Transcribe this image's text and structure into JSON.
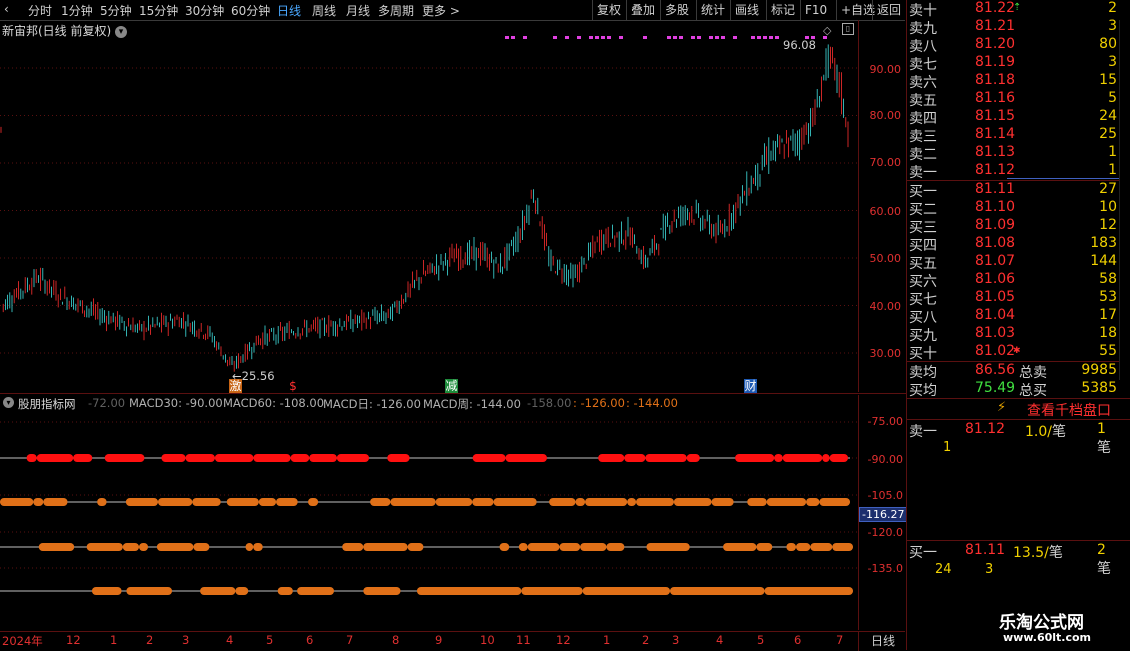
{
  "toolbar": {
    "periods": [
      "分时",
      "1分钟",
      "5分钟",
      "15分钟",
      "30分钟",
      "60分钟",
      "日线",
      "周线",
      "月线",
      "多周期",
      "更多 >"
    ],
    "active_period": "日线",
    "right_buttons": [
      "复权",
      "叠加",
      "多股",
      "统计",
      "画线",
      "F10",
      "+自选",
      "返回"
    ],
    "right_buttons_extra": [
      "标记"
    ]
  },
  "chart": {
    "title": "新宙邦(日线 前复权)",
    "y_ticks": [
      "90.00",
      "80.00",
      "70.00",
      "60.00",
      "50.00",
      "40.00",
      "30.00"
    ],
    "high_label": "96.08",
    "low_label": "25.56",
    "markers": [
      {
        "text": "激",
        "color": "#ffffff",
        "bg": "#c86414"
      },
      {
        "text": "$",
        "color": "#ff3030",
        "bg": ""
      },
      {
        "text": "减",
        "color": "#ffffff",
        "bg": "#1e8c3c"
      },
      {
        "text": "财",
        "color": "#ffffff",
        "bg": "#1e5ab4"
      }
    ]
  },
  "indicator": {
    "name": "股朋指标网",
    "header_items": [
      {
        "text": "-72.00",
        "color": "#606060"
      },
      {
        "text": "MACD30: -90.00",
        "color": "#b0b0b0"
      },
      {
        "text": "MACD60: -108.00",
        "color": "#b0b0b0"
      },
      {
        "text": "MACD日: -126.00",
        "color": "#b0b0b0"
      },
      {
        "text": "MACD周: -144.00",
        "color": "#b0b0b0"
      },
      {
        "text": "-158.00",
        "color": "#606060"
      },
      {
        "text": ": -126.00",
        "color": "#e07018"
      },
      {
        "text": ": -144.00",
        "color": "#e07018"
      }
    ],
    "y_ticks": [
      "-75.00",
      "-90.00",
      "-105.0",
      "-120.0",
      "-135.0"
    ],
    "current_value": "-116.27"
  },
  "timeline": {
    "labels": [
      "2024年",
      "12",
      "1",
      "2",
      "3",
      "4",
      "5",
      "6",
      "7",
      "8",
      "9",
      "10",
      "11",
      "12",
      "1",
      "2",
      "3",
      "4",
      "5",
      "6",
      "7"
    ],
    "period_label": "日线"
  },
  "orderbook": {
    "sells": [
      {
        "label": "卖十",
        "price": "81.22",
        "vol": "2"
      },
      {
        "label": "卖九",
        "price": "81.21",
        "vol": "3"
      },
      {
        "label": "卖八",
        "price": "81.20",
        "vol": "80"
      },
      {
        "label": "卖七",
        "price": "81.19",
        "vol": "3"
      },
      {
        "label": "卖六",
        "price": "81.18",
        "vol": "15"
      },
      {
        "label": "卖五",
        "price": "81.16",
        "vol": "5"
      },
      {
        "label": "卖四",
        "price": "81.15",
        "vol": "24"
      },
      {
        "label": "卖三",
        "price": "81.14",
        "vol": "25"
      },
      {
        "label": "卖二",
        "price": "81.13",
        "vol": "1"
      },
      {
        "label": "卖一",
        "price": "81.12",
        "vol": "1"
      }
    ],
    "buys": [
      {
        "label": "买一",
        "price": "81.11",
        "vol": "27"
      },
      {
        "label": "买二",
        "price": "81.10",
        "vol": "10"
      },
      {
        "label": "买三",
        "price": "81.09",
        "vol": "12"
      },
      {
        "label": "买四",
        "price": "81.08",
        "vol": "183"
      },
      {
        "label": "买五",
        "price": "81.07",
        "vol": "144"
      },
      {
        "label": "买六",
        "price": "81.06",
        "vol": "58"
      },
      {
        "label": "买七",
        "price": "81.05",
        "vol": "53"
      },
      {
        "label": "买八",
        "price": "81.04",
        "vol": "17"
      },
      {
        "label": "买九",
        "price": "81.03",
        "vol": "18"
      },
      {
        "label": "买十",
        "price": "81.02",
        "vol": "55"
      }
    ],
    "sell_avg_label": "卖均",
    "sell_avg": "86.56",
    "total_sell_label": "总卖",
    "total_sell": "9985",
    "buy_avg_label": "买均",
    "buy_avg": "75.49",
    "total_buy_label": "总买",
    "total_buy": "5385",
    "view_button": "查看千档盘口",
    "ask1": {
      "label": "卖一",
      "price": "81.12",
      "per": "1.0/",
      "unit": "笔",
      "count": "1",
      "unit2": "笔",
      "detail": "1"
    },
    "bid1": {
      "label": "买一",
      "price": "81.11",
      "per": "13.5/",
      "unit": "笔",
      "count": "2",
      "unit2": "笔",
      "detail1": "24",
      "detail2": "3"
    }
  },
  "watermark": {
    "line1": "乐淘公式网",
    "line2": "www.60lt.com"
  },
  "colors": {
    "up": "#ff3030",
    "down": "#40e0e0",
    "axis": "#e03030",
    "magenta": "#e040e0",
    "orange": "#e07018",
    "red_dots": "#ff1010"
  }
}
